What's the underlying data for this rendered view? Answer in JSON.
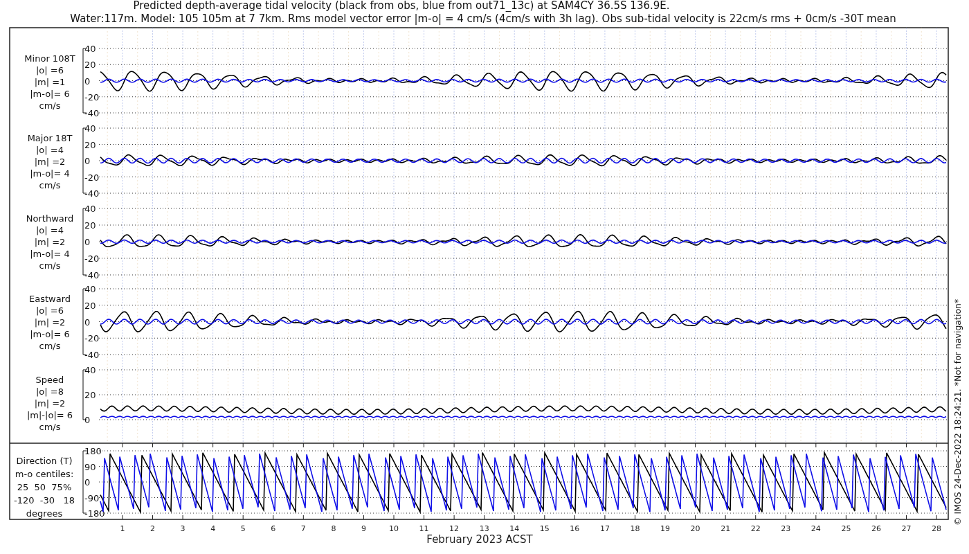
{
  "title_lines": [
    "Predicted depth-average tidal velocity (black from obs, blue from out71_13c) at SAM4CY 36.5S 136.9E.",
    "Water:117m. Model: 105 105m at 7 7km. Rms model vector error |m-o| = 4 cm/s (4cm/s with 3h lag). Obs sub-tidal velocity is 22cm/s rms + 0cm/s -30T mean"
  ],
  "panels": [
    {
      "kind": "velocity",
      "label_lines": [
        "Minor 108T",
        "|o| =6",
        "|m| =1",
        "|m-o|= 6",
        "cm/s"
      ],
      "yticks": [
        "40",
        "20",
        "0",
        "-20",
        "-40"
      ]
    },
    {
      "kind": "velocity",
      "label_lines": [
        "Major 18T",
        "|o| =4",
        "|m| =2",
        "|m-o|= 4",
        "cm/s"
      ],
      "yticks": [
        "40",
        "20",
        "0",
        "-20",
        "-40"
      ]
    },
    {
      "kind": "velocity",
      "label_lines": [
        "Northward",
        "|o| =4",
        "|m| =2",
        "|m-o|= 4",
        "cm/s"
      ],
      "yticks": [
        "40",
        "20",
        "0",
        "-20",
        "-40"
      ]
    },
    {
      "kind": "velocity",
      "label_lines": [
        "Eastward",
        "|o| =6",
        "|m| =2",
        "|m-o|= 6",
        "cm/s"
      ],
      "yticks": [
        "40",
        "20",
        "0",
        "-20",
        "-40"
      ]
    },
    {
      "kind": "speed",
      "label_lines": [
        "Speed",
        "|o| =8",
        "|m| =2",
        "|m|-|o|= 6",
        "cm/s"
      ],
      "yticks": [
        "40",
        "20",
        "0"
      ]
    },
    {
      "kind": "direction",
      "label_lines": [
        "Direction (T)",
        "m-o centiles:",
        "25  50  75%",
        "-120  -30   18",
        "degrees"
      ],
      "yticks": [
        "180",
        "90",
        "0",
        "-90",
        "-180"
      ]
    }
  ],
  "xticks": [
    "1",
    "2",
    "3",
    "4",
    "5",
    "6",
    "7",
    "8",
    "9",
    "10",
    "11",
    "12",
    "13",
    "14",
    "15",
    "16",
    "17",
    "18",
    "19",
    "20",
    "21",
    "22",
    "23",
    "24",
    "25",
    "26",
    "27",
    "28"
  ],
  "xlabel": "February 2023 ACST",
  "credit": "© IMOS 24-Dec-2022 18:24:21.  *Not for navigation*"
}
